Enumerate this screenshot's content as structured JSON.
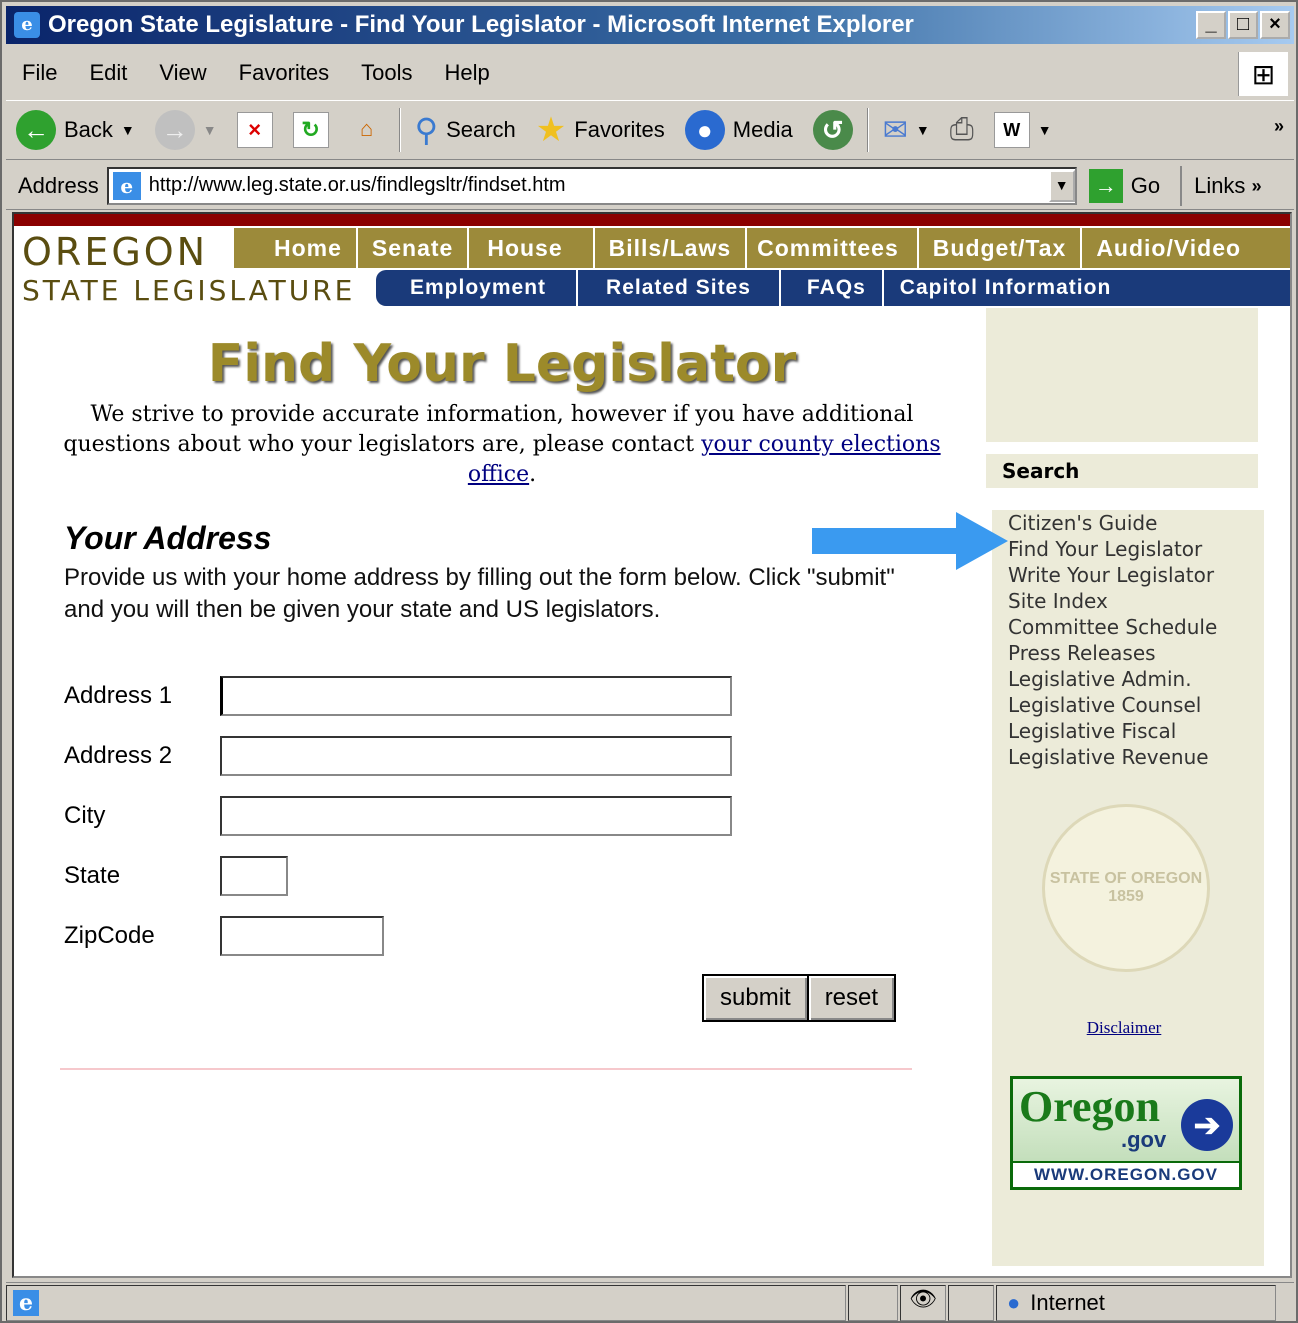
{
  "window": {
    "title": "Oregon State Legislature - Find Your Legislator - Microsoft Internet Explorer"
  },
  "menubar": {
    "items": [
      "File",
      "Edit",
      "View",
      "Favorites",
      "Tools",
      "Help"
    ]
  },
  "toolbar": {
    "back_label": "Back",
    "search_label": "Search",
    "favorites_label": "Favorites",
    "media_label": "Media"
  },
  "addressbar": {
    "label": "Address",
    "url": "http://www.leg.state.or.us/findlegsltr/findset.htm",
    "go_label": "Go",
    "links_label": "Links"
  },
  "site": {
    "logo_line1": "OREGON",
    "logo_line2": "STATE LEGISLATURE",
    "nav_primary": [
      "Home",
      "Senate",
      "House",
      "Bills/Laws",
      "Committees",
      "Budget/Tax",
      "Audio/Video"
    ],
    "nav_secondary": [
      "Employment",
      "Related Sites",
      "FAQs",
      "Capitol Information"
    ]
  },
  "sidebar": {
    "search_label": "Search",
    "links": [
      "Citizen's Guide",
      "Find Your Legislator",
      "Write Your Legislator",
      "Site Index",
      "Committee Schedule",
      "Press Releases",
      "Legislative Admin.",
      "Legislative Counsel",
      "Legislative Fiscal",
      "Legislative Revenue"
    ],
    "seal_text": "STATE OF OREGON 1859",
    "disclaimer": "Disclaimer",
    "oregon_gov": {
      "name": "Oregon",
      "suffix": ".gov",
      "url_text": "WWW.OREGON.GOV"
    }
  },
  "main": {
    "title": "Find Your Legislator",
    "intro_text": "We strive to provide accurate information, however if you have additional questions about who your legislators are, please contact ",
    "intro_link": "your county elections office",
    "intro_end": ".",
    "address_heading": "Your Address",
    "address_desc": "Provide us with your home address by filling out the form below. Click \"submit\" and you will then be given your state and US legislators.",
    "form": {
      "address1_label": "Address 1",
      "address2_label": "Address 2",
      "city_label": "City",
      "state_label": "State",
      "zip_label": "ZipCode",
      "submit_label": "submit",
      "reset_label": "reset"
    }
  },
  "statusbar": {
    "zone": "Internet"
  },
  "colors": {
    "gold": "#9c8a3a",
    "navy": "#1a3a7a",
    "arrow": "#3a9af0",
    "sidebar": "#ecebd9"
  }
}
